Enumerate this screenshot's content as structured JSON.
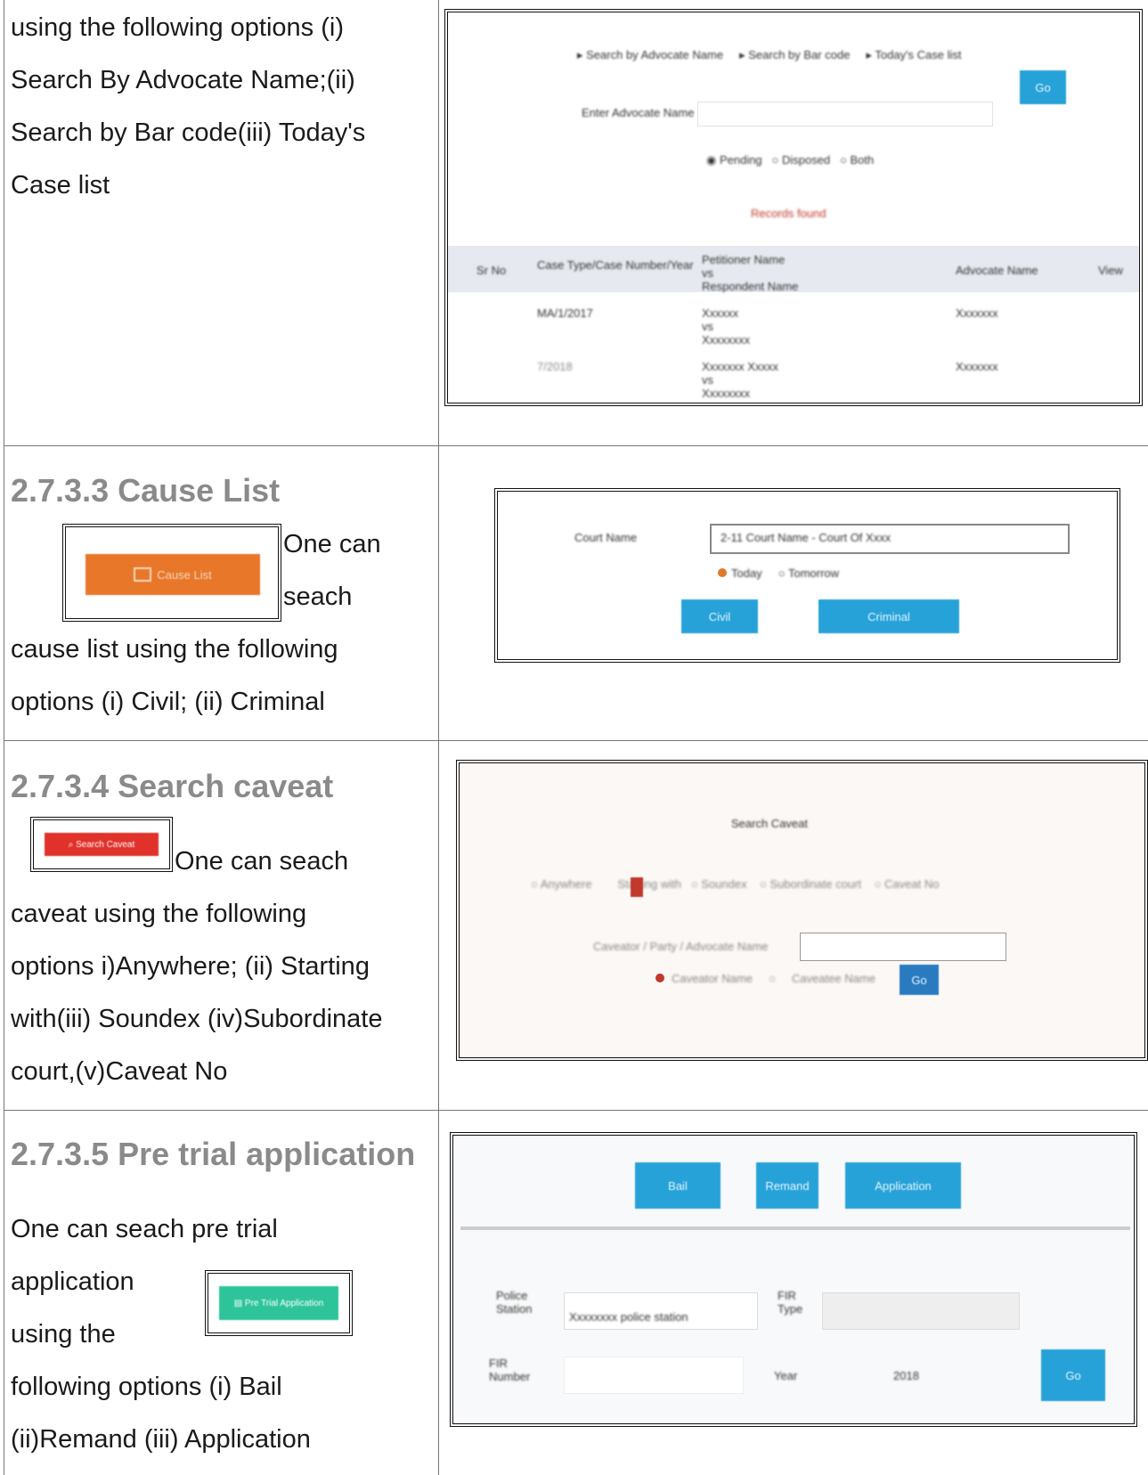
{
  "row1": {
    "description": [
      "using the following options (i)",
      "Search By Advocate Name;(ii)",
      "Search by Bar code(iii) Today's",
      "Case list"
    ]
  },
  "row2": {
    "heading": "2.7.3.3 Cause List",
    "button_label": "Cause List",
    "desc_right": [
      "One can",
      "seach"
    ],
    "desc_rest": [
      "cause list using the following",
      "options (i) Civil; (ii) Criminal"
    ],
    "screenshot_btn_civil": "Civil",
    "screenshot_btn_criminal": "Criminal"
  },
  "row3": {
    "heading": "2.7.3.4 Search caveat",
    "desc_right": "One can seach",
    "desc_rest": [
      "caveat  using the following",
      "options i)Anywhere; (ii) Starting",
      "with(iii) Soundex (iv)Subordinate",
      "court,(v)Caveat No"
    ]
  },
  "row4": {
    "heading": "2.7.3.5 Pre trial application",
    "desc": [
      "One can seach pre trial",
      "application",
      "using the",
      "following options (i) Bail",
      "(ii)Remand (iii) Application"
    ],
    "screenshot_year": "2018"
  },
  "colors": {
    "heading": "#8a8a8a",
    "orange_button": "#e8772a",
    "red_button": "#e0322a",
    "green_button": "#2ec49a",
    "blue_button": "#27a2d8"
  }
}
